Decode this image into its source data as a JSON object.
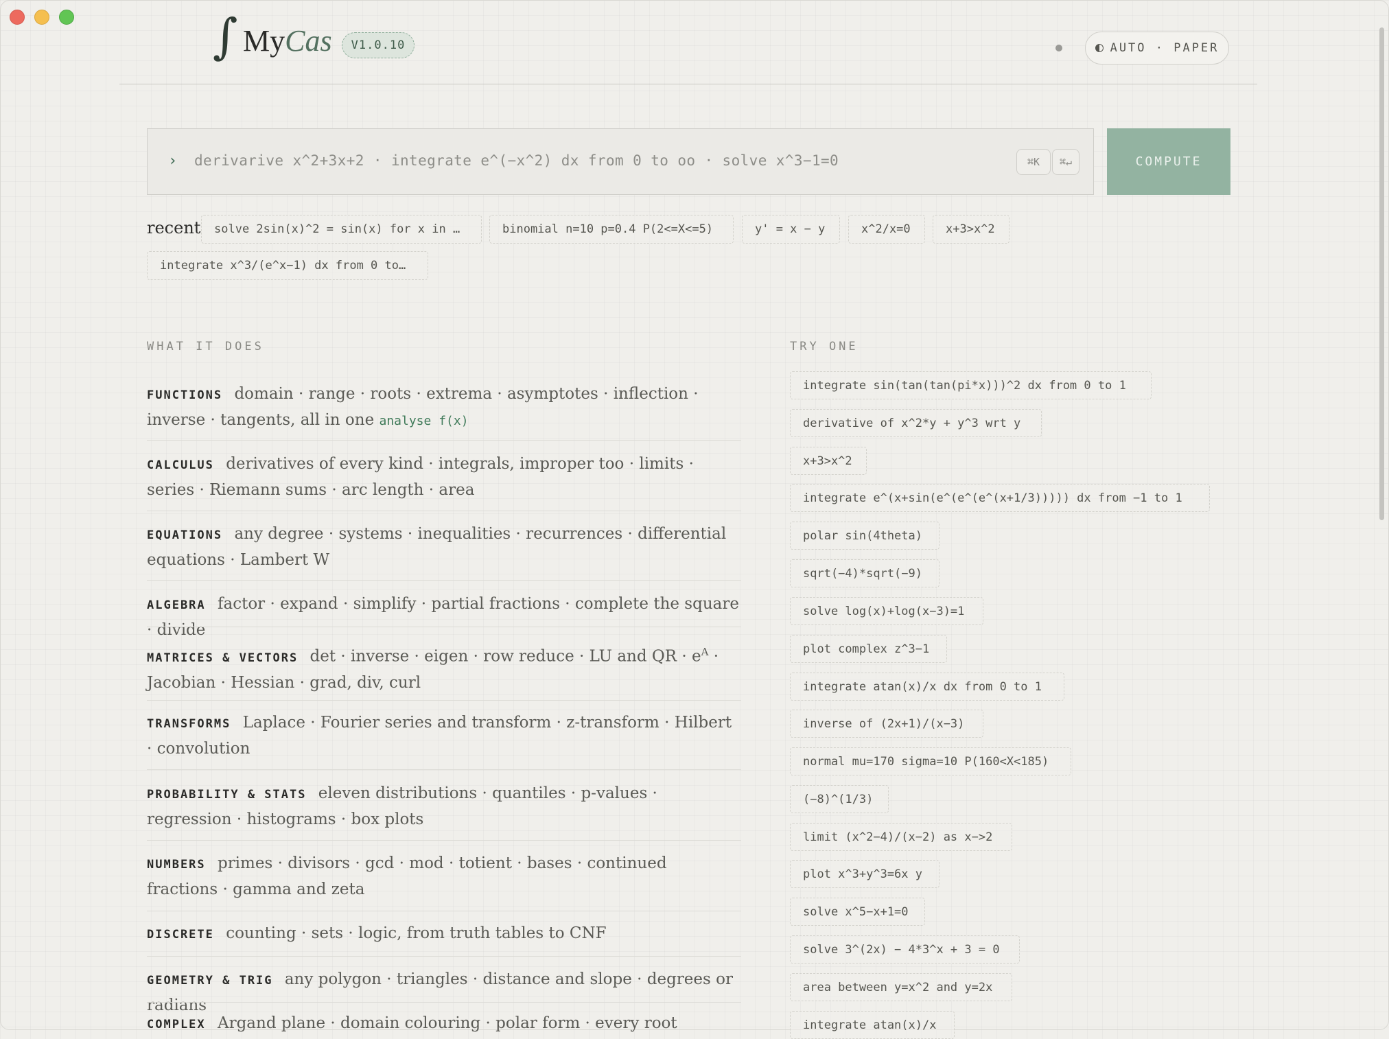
{
  "header": {
    "logo_symbol": "∫",
    "app_name_prefix": "My",
    "app_name_suffix": "Cas",
    "version": "V1.0.10",
    "theme_label": "AUTO · PAPER"
  },
  "search": {
    "prompt": "›",
    "placeholder": "derivarive x^2+3x+2 · integrate e^(−x^2) dx from 0 to oo · solve x^3−1=0",
    "shortcut_1": "⌘K",
    "shortcut_2": "⌘↵",
    "compute_label": "COMPUTE"
  },
  "recent": {
    "label": "recent",
    "items": [
      "solve 2sin(x)^2 = sin(x) for x in …",
      "binomial n=10 p=0.4 P(2<=X<=5)",
      "y' = x − y",
      "x^2/x=0",
      "x+3>x^2",
      "integrate x^3/(e^x−1) dx from 0 to…"
    ]
  },
  "what_it_does": {
    "heading": "WHAT IT DOES",
    "features": [
      {
        "name": "FUNCTIONS",
        "text": "domain · range · roots · extrema · asymptotes · inflection · inverse · tangents, all in one",
        "code": "analyse f(x)"
      },
      {
        "name": "CALCULUS",
        "text": "derivatives of every kind · integrals, improper too · limits · series · Riemann sums · arc length · area"
      },
      {
        "name": "EQUATIONS",
        "text": "any degree · systems · inequalities · recurrences · differential equations · Lambert W"
      },
      {
        "name": "ALGEBRA",
        "text": "factor · expand · simplify · partial fractions · complete the square · divide"
      },
      {
        "name": "MATRICES & VECTORS",
        "text_before": "det · inverse · eigen · row reduce · LU and QR · e",
        "sup": "A",
        "text_after": " · Jacobian · Hessian · grad, div, curl"
      },
      {
        "name": "TRANSFORMS",
        "text": "Laplace · Fourier series and transform · z-transform · Hilbert · convolution"
      },
      {
        "name": "PROBABILITY & STATS",
        "text": "eleven distributions · quantiles · p-values · regression · histograms · box plots"
      },
      {
        "name": "NUMBERS",
        "text": "primes · divisors · gcd · mod · totient · bases · continued fractions · gamma and zeta"
      },
      {
        "name": "DISCRETE",
        "text": "counting · sets · logic, from truth tables to CNF"
      },
      {
        "name": "GEOMETRY & TRIG",
        "text": "any polygon · triangles · distance and slope · degrees or radians"
      },
      {
        "name": "COMPLEX",
        "text": "Argand plane · domain colouring · polar form · every root"
      }
    ]
  },
  "try_one": {
    "heading": "TRY ONE",
    "examples": [
      "integrate sin(tan(tan(pi*x)))^2 dx from 0 to 1",
      "derivative of x^2*y + y^3 wrt y",
      "x+3>x^2",
      "integrate e^(x+sin(e^(e^(e^(x+1/3))))) dx from −1 to 1",
      "polar sin(4theta)",
      "sqrt(−4)*sqrt(−9)",
      "solve log(x)+log(x−3)=1",
      "plot complex z^3−1",
      "integrate atan(x)/x dx from 0 to 1",
      "inverse of (2x+1)/(x−3)",
      "normal mu=170 sigma=10 P(160<X<185)",
      "(−8)^(1/3)",
      "limit (x^2−4)/(x−2) as x−>2",
      "plot x^3+y^3=6x y",
      "solve x^5−x+1=0",
      "solve 3^(2x) − 4*3^x + 3 = 0",
      "area between y=x^2 and y=2x",
      "integrate atan(x)/x"
    ]
  }
}
